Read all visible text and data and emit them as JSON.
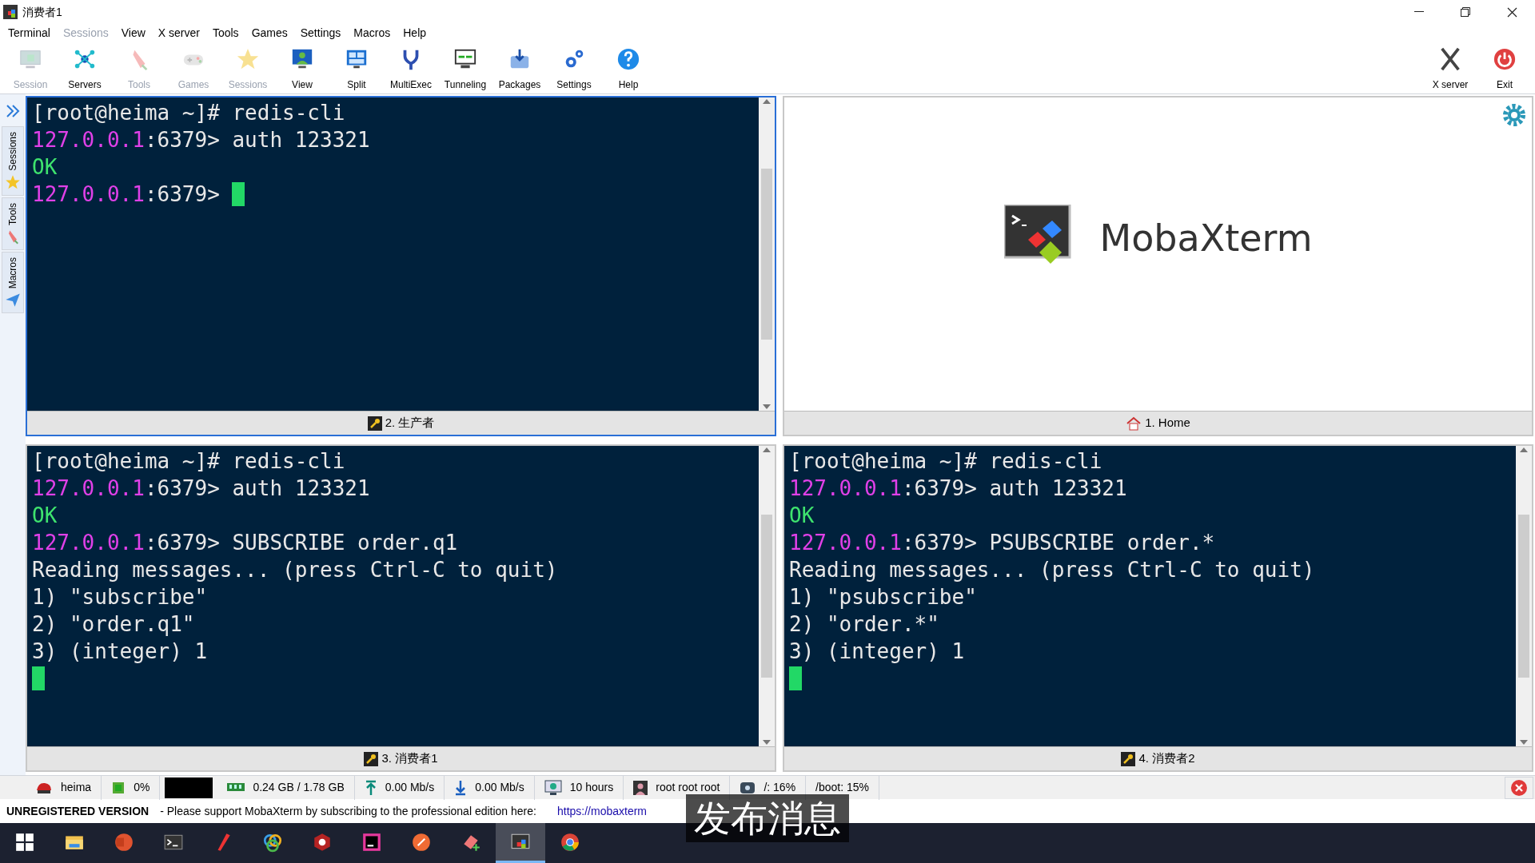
{
  "window": {
    "title": "消费者1"
  },
  "menu": [
    {
      "label": "Terminal",
      "disabled": false
    },
    {
      "label": "Sessions",
      "disabled": true
    },
    {
      "label": "View",
      "disabled": false
    },
    {
      "label": "X server",
      "disabled": false
    },
    {
      "label": "Tools",
      "disabled": false
    },
    {
      "label": "Games",
      "disabled": false
    },
    {
      "label": "Settings",
      "disabled": false
    },
    {
      "label": "Macros",
      "disabled": false
    },
    {
      "label": "Help",
      "disabled": false
    }
  ],
  "toolbar": [
    {
      "label": "Session",
      "kind": "monitor",
      "disabled": true
    },
    {
      "label": "Servers",
      "kind": "servers",
      "disabled": false
    },
    {
      "label": "Tools",
      "kind": "knife",
      "disabled": true
    },
    {
      "label": "Games",
      "kind": "gamepad",
      "disabled": true
    },
    {
      "label": "Sessions",
      "kind": "star",
      "disabled": true
    },
    {
      "label": "View",
      "kind": "view",
      "disabled": false
    },
    {
      "label": "Split",
      "kind": "split",
      "disabled": false
    },
    {
      "label": "MultiExec",
      "kind": "fork",
      "disabled": false
    },
    {
      "label": "Tunneling",
      "kind": "tunnel",
      "disabled": false
    },
    {
      "label": "Packages",
      "kind": "package",
      "disabled": false
    },
    {
      "label": "Settings",
      "kind": "gears",
      "disabled": false
    },
    {
      "label": "Help",
      "kind": "help",
      "disabled": false
    }
  ],
  "toolbar_right": [
    {
      "label": "X server",
      "kind": "x"
    },
    {
      "label": "Exit",
      "kind": "power"
    }
  ],
  "sidebar": [
    {
      "label": "Sessions",
      "kind": "star"
    },
    {
      "label": "Tools",
      "kind": "knife"
    },
    {
      "label": "Macros",
      "kind": "plane"
    }
  ],
  "panes": [
    {
      "kind": "terminal",
      "selected": true,
      "tab": "2. 生产者",
      "lines": [
        [
          {
            "kind": "plain",
            "text": "[root@heima ~]# redis-cli"
          }
        ],
        [
          {
            "kind": "host",
            "text": "127.0.0.1"
          },
          {
            "kind": "plain",
            "text": ":6379> auth 123321"
          }
        ],
        [
          {
            "kind": "ok",
            "text": "OK"
          }
        ],
        [
          {
            "kind": "host",
            "text": "127.0.0.1"
          },
          {
            "kind": "plain",
            "text": ":6379> "
          },
          {
            "kind": "cursor"
          }
        ]
      ]
    },
    {
      "kind": "home",
      "selected": false,
      "tab": "1. Home",
      "logo": "MobaXterm"
    },
    {
      "kind": "terminal",
      "selected": false,
      "tab": "3. 消费者1",
      "lines": [
        [
          {
            "kind": "plain",
            "text": "[root@heima ~]# redis-cli"
          }
        ],
        [
          {
            "kind": "host",
            "text": "127.0.0.1"
          },
          {
            "kind": "plain",
            "text": ":6379> auth 123321"
          }
        ],
        [
          {
            "kind": "ok",
            "text": "OK"
          }
        ],
        [
          {
            "kind": "host",
            "text": "127.0.0.1"
          },
          {
            "kind": "plain",
            "text": ":6379> SUBSCRIBE order.q1"
          }
        ],
        [
          {
            "kind": "plain",
            "text": "Reading messages... (press Ctrl-C to quit)"
          }
        ],
        [
          {
            "kind": "plain",
            "text": "1) \"subscribe\""
          }
        ],
        [
          {
            "kind": "plain",
            "text": "2) \"order.q1\""
          }
        ],
        [
          {
            "kind": "plain",
            "text": "3) (integer) 1"
          }
        ],
        [
          {
            "kind": "cursor"
          }
        ]
      ]
    },
    {
      "kind": "terminal",
      "selected": false,
      "tab": "4. 消费者2",
      "lines": [
        [
          {
            "kind": "plain",
            "text": "[root@heima ~]# redis-cli"
          }
        ],
        [
          {
            "kind": "host",
            "text": "127.0.0.1"
          },
          {
            "kind": "plain",
            "text": ":6379> auth 123321"
          }
        ],
        [
          {
            "kind": "ok",
            "text": "OK"
          }
        ],
        [
          {
            "kind": "host",
            "text": "127.0.0.1"
          },
          {
            "kind": "plain",
            "text": ":6379> PSUBSCRIBE order.*"
          }
        ],
        [
          {
            "kind": "plain",
            "text": "Reading messages... (press Ctrl-C to quit)"
          }
        ],
        [
          {
            "kind": "plain",
            "text": "1) \"psubscribe\""
          }
        ],
        [
          {
            "kind": "plain",
            "text": "2) \"order.*\""
          }
        ],
        [
          {
            "kind": "plain",
            "text": "3) (integer) 1"
          }
        ],
        [
          {
            "kind": "cursor"
          }
        ]
      ]
    }
  ],
  "status_bar": [
    {
      "kind": "host",
      "text": "heima"
    },
    {
      "kind": "cpu",
      "text": "0%"
    },
    {
      "kind": "graph"
    },
    {
      "kind": "ram",
      "text": "0.24 GB / 1.78 GB"
    },
    {
      "kind": "up",
      "text": "0.00 Mb/s"
    },
    {
      "kind": "down",
      "text": "0.00 Mb/s"
    },
    {
      "kind": "uptime",
      "text": "10 hours"
    },
    {
      "kind": "user",
      "text": "root  root  root"
    },
    {
      "kind": "disk",
      "text": "/: 16%"
    },
    {
      "kind": "plain",
      "text": "/boot: 15%"
    }
  ],
  "notice": {
    "label": "UNREGISTERED VERSION",
    "text": "-  Please support MobaXterm by subscribing to the professional edition here:",
    "link": "https://mobaxterm"
  },
  "caption": "发布消息",
  "taskbar": [
    {
      "kind": "windows",
      "selected": false
    },
    {
      "kind": "folder",
      "selected": false
    },
    {
      "kind": "slides",
      "selected": false
    },
    {
      "kind": "terminal",
      "selected": false
    },
    {
      "kind": "pen",
      "selected": false
    },
    {
      "kind": "rings",
      "selected": false
    },
    {
      "kind": "redis",
      "selected": false
    },
    {
      "kind": "ide",
      "selected": false
    },
    {
      "kind": "rocket",
      "selected": false
    },
    {
      "kind": "eraser",
      "selected": false
    },
    {
      "kind": "moba",
      "selected": true
    },
    {
      "kind": "chrome",
      "selected": false
    }
  ]
}
